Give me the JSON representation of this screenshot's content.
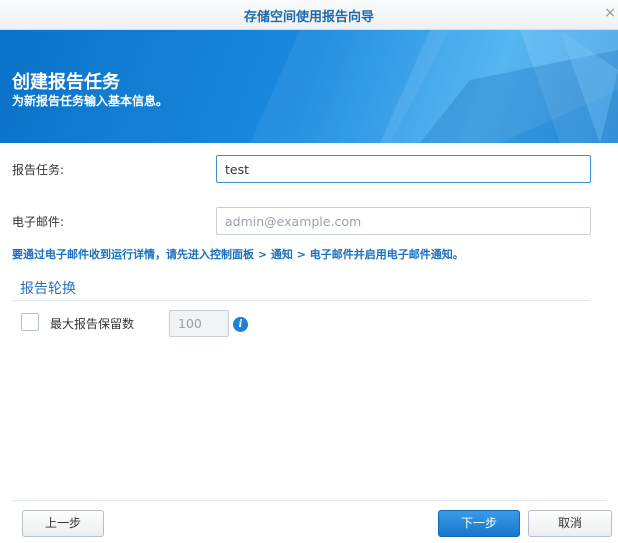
{
  "window": {
    "title": "存储空间使用报告向导",
    "close_glyph": "×"
  },
  "banner": {
    "heading": "创建报告任务",
    "subtitle": "为新报告任务输入基本信息。"
  },
  "form": {
    "task_label": "报告任务:",
    "task_value": "test",
    "email_label": "电子邮件:",
    "email_value": "",
    "email_placeholder": "admin@example.com",
    "email_note": "要通过电子邮件收到运行详情，请先进入控制面板 > 通知 > 电子邮件并启用电子邮件通知。"
  },
  "rotation": {
    "section_title": "报告轮换",
    "max_reports_label": "最大报告保留数",
    "max_reports_checked": false,
    "max_reports_value": "100",
    "info_glyph": "i"
  },
  "footer": {
    "back_label": "上一步",
    "next_label": "下一步",
    "cancel_label": "取消"
  },
  "colors": {
    "accent": "#1a70c0",
    "banner": "#1a8ae0",
    "primary_button": "#2488d8"
  },
  "icons": [
    "close-icon",
    "info-icon"
  ]
}
